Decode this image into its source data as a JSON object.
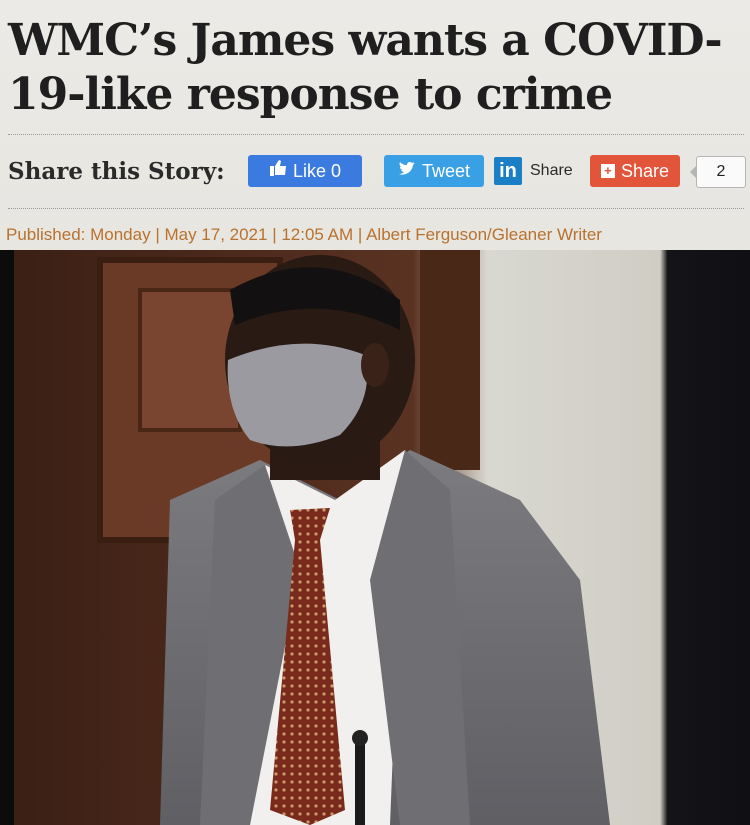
{
  "article": {
    "headline": "WMC’s James wants a COVID-19-like response to crime",
    "published_line": "Published: Monday | May 17, 2021 | 12:05 AM | Albert Ferguson/Gleaner Writer"
  },
  "share": {
    "label": "Share this Story:",
    "like_label": "Like 0",
    "tweet_label": "Tweet",
    "linkedin_label": "Share",
    "share_label": "Share",
    "share_count": "2"
  },
  "photo": {
    "subject": "man in grey suit wearing grey face mask standing in room with wooden door"
  },
  "colors": {
    "like": "#3b7be0",
    "tweet": "#3aa0e6",
    "linkedin": "#1a7fc4",
    "share": "#e2553a",
    "published_text": "#b8722e"
  },
  "icons": [
    "thumbs-up-icon",
    "twitter-bird-icon",
    "linkedin-icon",
    "plus-icon"
  ]
}
